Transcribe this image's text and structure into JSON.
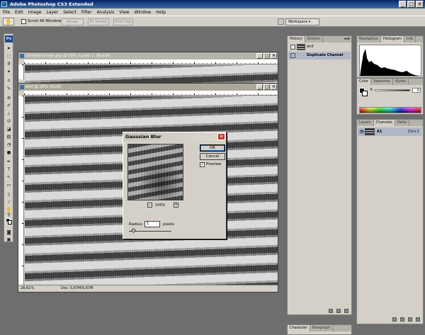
{
  "app": {
    "title": "Adobe Photoshop CS3 Extended",
    "window_controls": [
      "_",
      "□",
      "✕"
    ]
  },
  "menu": [
    "File",
    "Edit",
    "Image",
    "Layer",
    "Select",
    "Filter",
    "Analysis",
    "View",
    "Window",
    "Help"
  ],
  "options_bar": {
    "tool_glyph": "✋",
    "scroll_all_windows": "Scroll All Windows",
    "actual_pixels": "Actual Pixels",
    "fit_screen": "Fit Screen",
    "print_size": "Print Size",
    "workspace": "Workspace ▾"
  },
  "documents": [
    {
      "title": "Untitled image.jpg @ 50% (Layer 1, Blue/8)",
      "controls": [
        "_",
        "□",
        "✕"
      ]
    },
    {
      "title": "dmf @ 28% (A1/8)",
      "controls": [
        "_",
        "□",
        "✕"
      ],
      "zoom": "28,61%",
      "doc_info": "Doc: 5,67M/5,67M"
    }
  ],
  "dialog": {
    "title": "Gaussian Blur",
    "ok": "OK",
    "cancel": "Cancel",
    "preview_label": "Preview",
    "preview_checked": true,
    "zoom": "100%",
    "radius_label": "Radius:",
    "radius_value": "1",
    "radius_unit": "pixels",
    "zoom_out_glyph": "−",
    "zoom_in_glyph": "+",
    "close_glyph": "✕",
    "check_glyph": "✓"
  },
  "history_panel": {
    "tabs": [
      "History",
      "Actions"
    ],
    "rows": [
      {
        "label": "dmf",
        "selected": false
      },
      {
        "label": "Duplicate Channel",
        "selected": true
      }
    ]
  },
  "navigator_panel": {
    "tabs": [
      "Navigation",
      "Histogram",
      "Info"
    ]
  },
  "color_panel": {
    "tabs": [
      "Color",
      "Swatches",
      "Styles"
    ],
    "k_label": "K",
    "k_value": "0"
  },
  "layers_panel": {
    "tabs": [
      "Layers",
      "Channels",
      "Paths"
    ],
    "layer_name": "A1",
    "shortcut": "Ctrl+1",
    "eye_glyph": "👁"
  },
  "character_panel": {
    "tabs": [
      "Character",
      "Paragraph"
    ]
  },
  "menu_glyph": "▸≡",
  "colors": {
    "titlebar": "#0a246a",
    "chrome": "#d4d0c8",
    "workspace": "#6e6e6e",
    "dialog_close": "#c0392b"
  }
}
